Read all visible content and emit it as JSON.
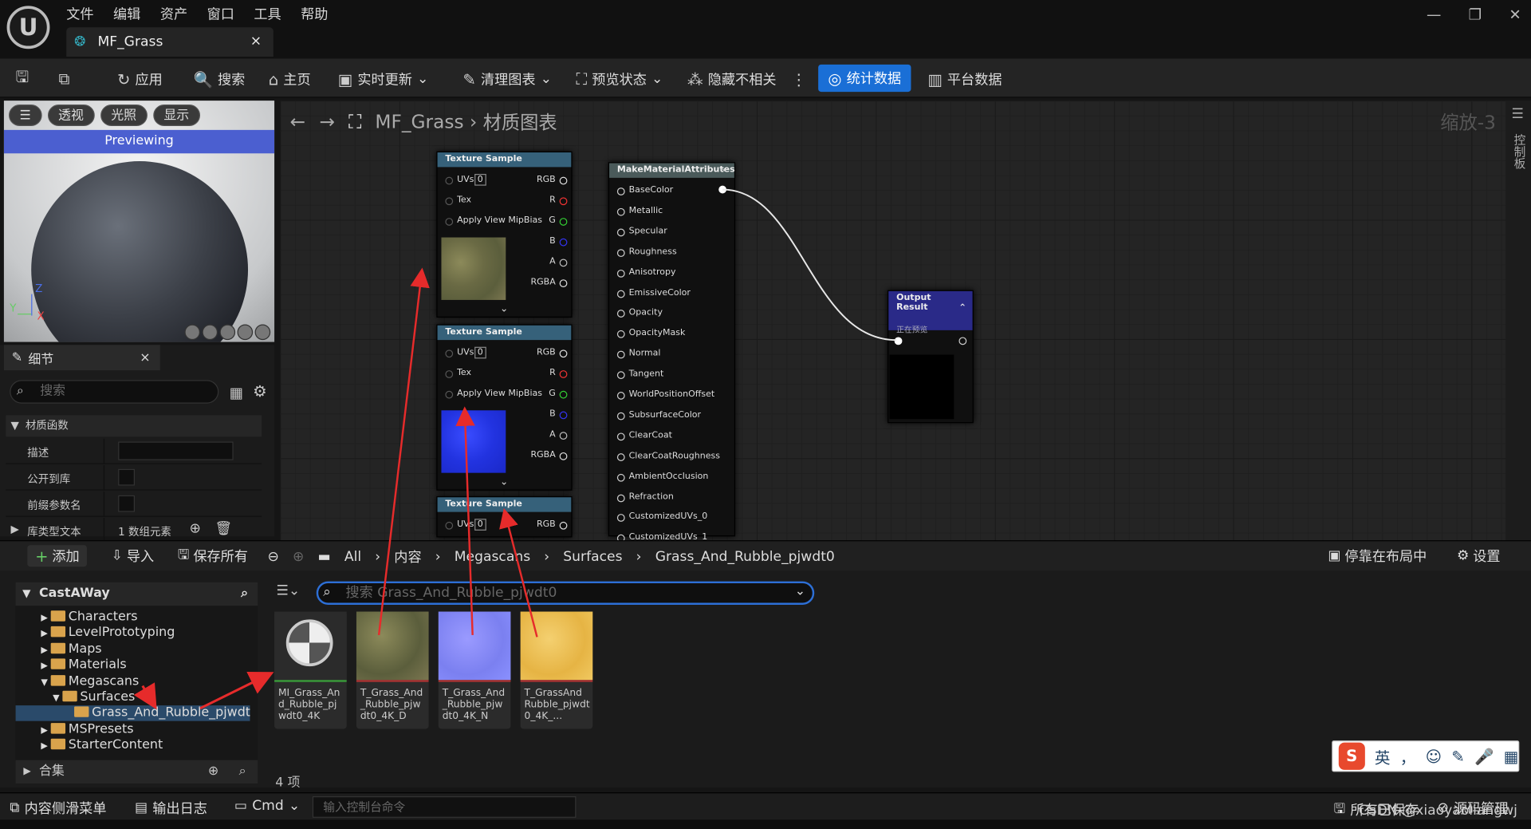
{
  "menu": [
    "文件",
    "编辑",
    "资产",
    "窗口",
    "工具",
    "帮助"
  ],
  "tab": {
    "title": "MF_Grass",
    "close": "×"
  },
  "window": {
    "min": "—",
    "restore": "❐",
    "close": "✕"
  },
  "toolbar": {
    "apply": "应用",
    "search": "搜索",
    "home": "主页",
    "live_update": "实时更新",
    "clean_graph": "清理图表",
    "preview_state": "预览状态",
    "hide_unrelated": "隐藏不相关",
    "stats": "统计数据",
    "platform_stats": "平台数据"
  },
  "viewport": {
    "perspective": "透视",
    "lit": "光照",
    "show": "显示",
    "previewing": "Previewing",
    "axis_z": "Z",
    "axis_y": "Y",
    "axis_x": "X"
  },
  "details": {
    "title": "细节",
    "search_placeholder": "搜索",
    "section": "材质函数",
    "rows": [
      {
        "label": "描述"
      },
      {
        "label": "公开到库"
      },
      {
        "label": "前缀参数名"
      },
      {
        "label": "库类型文本",
        "value": "1 数组元素"
      }
    ]
  },
  "graph": {
    "breadcrumb_root": "MF_Grass",
    "breadcrumb_sep": "›",
    "breadcrumb_page": "材质图表",
    "zoom": "缩放-3",
    "side_panel": "控制板",
    "texture_nodes": [
      {
        "title": "Texture Sample",
        "uvs": "UVs",
        "uv_index": "0",
        "tex": "Tex",
        "mip": "Apply View MipBias",
        "outputs": [
          "RGB",
          "R",
          "G",
          "B",
          "A",
          "RGBA"
        ],
        "preview": "grass diffuse"
      },
      {
        "title": "Texture Sample",
        "uvs": "UVs",
        "uv_index": "0",
        "tex": "Tex",
        "mip": "Apply View MipBias",
        "outputs": [
          "RGB",
          "R",
          "G",
          "B",
          "A",
          "RGBA"
        ],
        "preview": "grass normal"
      },
      {
        "title": "Texture Sample",
        "uvs": "UVs",
        "uv_index": "0",
        "outputs": [
          "RGB"
        ]
      }
    ],
    "make_attributes": {
      "title": "MakeMaterialAttributes",
      "pins": [
        "BaseColor",
        "Metallic",
        "Specular",
        "Roughness",
        "Anisotropy",
        "EmissiveColor",
        "Opacity",
        "OpacityMask",
        "Normal",
        "Tangent",
        "WorldPositionOffset",
        "SubsurfaceColor",
        "ClearCoat",
        "ClearCoatRoughness",
        "AmbientOcclusion",
        "Refraction",
        "CustomizedUVs_0",
        "CustomizedUVs_1"
      ]
    },
    "output_result": {
      "title": "Output Result",
      "subtitle": "正在预览"
    }
  },
  "content_browser": {
    "add": "添加",
    "import": "导入",
    "save_all": "保存所有",
    "path": [
      "All",
      "内容",
      "Megascans",
      "Surfaces",
      "Grass_And_Rubble_pjwdt0"
    ],
    "dock": "停靠在布局中",
    "settings": "设置",
    "tree_root": "CastAWay",
    "tree": [
      {
        "label": "Characters",
        "depth": 1
      },
      {
        "label": "LevelPrototyping",
        "depth": 1
      },
      {
        "label": "Maps",
        "depth": 1
      },
      {
        "label": "Materials",
        "depth": 1
      },
      {
        "label": "Megascans",
        "depth": 1
      },
      {
        "label": "Surfaces",
        "depth": 2
      },
      {
        "label": "Grass_And_Rubble_pjwdt0",
        "depth": 3
      },
      {
        "label": "MSPresets",
        "depth": 1
      },
      {
        "label": "StarterContent",
        "depth": 1
      }
    ],
    "collections": "合集",
    "search_placeholder": "搜索 Grass_And_Rubble_pjwdt0",
    "assets": [
      {
        "name": "MI_Grass_And_Rubble_pjwdt0_4K",
        "kind": "material-instance"
      },
      {
        "name": "T_Grass_And_Rubble_pjwdt0_4K_D",
        "kind": "diffuse"
      },
      {
        "name": "T_Grass_And_Rubble_pjwdt0_4K_N",
        "kind": "normal"
      },
      {
        "name": "T_GrassAnd Rubble_pjwdt0_4K_...",
        "kind": "orm"
      }
    ],
    "count": "4 项"
  },
  "status": {
    "content_drawer": "内容侧滑菜单",
    "output_log": "输出日志",
    "cmd": "Cmd",
    "cmd_placeholder": "输入控制台命令",
    "saved": "所有已保存",
    "source_control": "源码管理"
  },
  "ime": {
    "logo": "S",
    "lang": "英",
    "punct": "，"
  },
  "watermark": "CSDN @xiaoyaoliangwj",
  "colors": {
    "accent": "#1a6fd6",
    "node_header": "#36617a",
    "output_node": "#2a2a88",
    "folder": "#d9a34c",
    "annotation_arrow": "#e62b2b"
  }
}
